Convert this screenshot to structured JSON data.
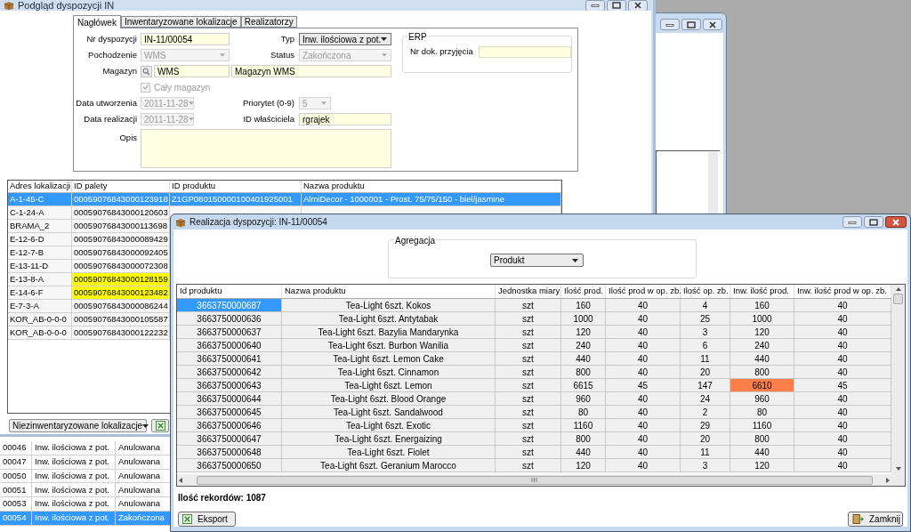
{
  "main_window": {
    "title": "Podgląd dyspozycji IN",
    "tabs": [
      {
        "label": "Nagłówek",
        "selected": true
      },
      {
        "label": "Inwentaryzowane lokalizacje",
        "selected": false
      },
      {
        "label": "Realizatorzy",
        "selected": false
      }
    ],
    "form_rows": [
      {
        "label": "Nr dyspozycji",
        "field": {
          "kind": "text",
          "value": "IN-11/00054",
          "disabled": false
        },
        "label2": "Typ",
        "field2": {
          "kind": "dropdown",
          "value": "Inw. ilościowa z pot.",
          "disabled": false
        }
      },
      {
        "label": "Pochodzenie",
        "field": {
          "kind": "dropdown",
          "value": "WMS",
          "disabled": true
        },
        "label2": "Status",
        "field2": {
          "kind": "dropdown",
          "value": "Zakończona",
          "disabled": true
        }
      },
      {
        "label": "Magazyn",
        "field": {
          "kind": "lookup",
          "value": "WMS",
          "disabled": false
        },
        "field2": {
          "kind": "text",
          "value": "Magazyn WMS",
          "disabled": false
        }
      },
      {
        "field": {
          "kind": "checkbox",
          "value": "Cały magazyn",
          "checked": true,
          "disabled": true
        }
      },
      {
        "label": "Data utworzenia",
        "field": {
          "kind": "date",
          "value": "2011-11-28",
          "disabled": true
        },
        "label2": "Priorytet (0-9)",
        "field2": {
          "kind": "short_dropdown",
          "value": "5",
          "disabled": true
        }
      },
      {
        "label": "Data realizacji",
        "field": {
          "kind": "date",
          "value": "2011-11-28",
          "disabled": true
        },
        "label2": "ID właściciela",
        "field2": {
          "kind": "text",
          "value": "rgrajek",
          "disabled": false
        }
      },
      {
        "label": "Opis",
        "field": {
          "kind": "memo",
          "disabled": false
        }
      }
    ],
    "erp": {
      "legend": "ERP",
      "label": "Nr dok. przyjęcia"
    },
    "locations_table": {
      "columns": [
        "Adres lokalizacji",
        "ID palety",
        "ID produktu",
        "Nazwa produktu"
      ],
      "rows": [
        {
          "cells": [
            "A-1-45-C",
            "00059076843000123918",
            "Z1GP080150000100401925001",
            "AlmiDecor - 1000001 - Prost. 75/75/150 - biel/jasmine"
          ],
          "selected": true,
          "pallet_flagged": false
        },
        {
          "cells": [
            "C-1-24-A",
            "00059076843000120603"
          ],
          "selected": false,
          "pallet_flagged": false
        },
        {
          "cells": [
            "BRAMA_2",
            "00059076843000113698"
          ],
          "selected": false,
          "pallet_flagged": false
        },
        {
          "cells": [
            "E-12-6-D",
            "00059076843000089429"
          ],
          "selected": false,
          "pallet_flagged": false
        },
        {
          "cells": [
            "E-12-7-B",
            "00059076843000092405"
          ],
          "selected": false,
          "pallet_flagged": false
        },
        {
          "cells": [
            "E-13-11-D",
            "00059076843000072308"
          ],
          "selected": false,
          "pallet_flagged": false
        },
        {
          "cells": [
            "E-13-8-A",
            "00059076843000128159"
          ],
          "selected": false,
          "pallet_flagged": true
        },
        {
          "cells": [
            "E-14-6-F",
            "00059076843000123482"
          ],
          "selected": false,
          "pallet_flagged": true
        },
        {
          "cells": [
            "E-7-3-A",
            "00059076843000086244"
          ],
          "selected": false,
          "pallet_flagged": false
        },
        {
          "cells": [
            "KOR_AB-0-0-0",
            "00059076843000105587"
          ],
          "selected": false,
          "pallet_flagged": false
        },
        {
          "cells": [
            "KOR_AB-0-0-0",
            "00059076843000122232"
          ],
          "selected": false,
          "pallet_flagged": false
        }
      ]
    },
    "filter_dropdown": "Niezinwentaryzowane lokalizacje"
  },
  "background_list": {
    "rows": [
      {
        "cells": [
          "00046",
          "Inw. ilościowa z pot.",
          "Anulowana"
        ],
        "selected": false
      },
      {
        "cells": [
          "00047",
          "Inw. ilościowa z pot.",
          "Anulowana"
        ],
        "selected": false
      },
      {
        "cells": [
          "00050",
          "Inw. ilościowa z pot.",
          "Anulowana"
        ],
        "selected": false
      },
      {
        "cells": [
          "00051",
          "Inw. ilościowa z pot.",
          "Anulowana"
        ],
        "selected": false
      },
      {
        "cells": [
          "00053",
          "Inw. ilościowa z pot.",
          "Anulowana"
        ],
        "selected": false
      },
      {
        "cells": [
          "00054",
          "Inw. ilościowa z pot.",
          "Zakończona"
        ],
        "selected": true
      }
    ]
  },
  "dialog": {
    "title": "Realizacja dyspozycji: IN-11/00054",
    "aggregation": {
      "legend": "Agregacja",
      "value": "Produkt"
    },
    "columns": [
      "Id produktu",
      "Nazwa produktu",
      "Jednostka miary",
      "Ilość prod.",
      "Ilość prod w op. zb.",
      "Ilość op. zb.",
      "Inw. ilość prod.",
      "Inw. ilość prod w op. zb."
    ],
    "rows": [
      {
        "cells": [
          "3663750000687",
          "Tea-Light 6szt. Kokos",
          "szt",
          "160",
          "40",
          "4",
          "160",
          "40"
        ],
        "selected": true,
        "discrepancy": false
      },
      {
        "cells": [
          "3663750000636",
          "Tea-Light 6szt. Antytabak",
          "szt",
          "1000",
          "40",
          "25",
          "1000",
          "40"
        ],
        "selected": false,
        "discrepancy": false
      },
      {
        "cells": [
          "3663750000637",
          "Tea-Light 6szt. Bazylia Mandarynka",
          "szt",
          "120",
          "40",
          "3",
          "120",
          "40"
        ],
        "selected": false,
        "discrepancy": false
      },
      {
        "cells": [
          "3663750000640",
          "Tea-Light 6szt. Burbon Wanilia",
          "szt",
          "240",
          "40",
          "6",
          "240",
          "40"
        ],
        "selected": false,
        "discrepancy": false
      },
      {
        "cells": [
          "3663750000641",
          "Tea-Light 6szt. Lemon Cake",
          "szt",
          "440",
          "40",
          "11",
          "440",
          "40"
        ],
        "selected": false,
        "discrepancy": false
      },
      {
        "cells": [
          "3663750000642",
          "Tea-Light 6szt. Cinnamon",
          "szt",
          "800",
          "40",
          "20",
          "800",
          "40"
        ],
        "selected": false,
        "discrepancy": false
      },
      {
        "cells": [
          "3663750000643",
          "Tea-Light 6szt. Lemon",
          "szt",
          "6615",
          "45",
          "147",
          "6610",
          "45"
        ],
        "selected": false,
        "discrepancy": true
      },
      {
        "cells": [
          "3663750000644",
          "Tea-Light 6szt. Blood Orange",
          "szt",
          "960",
          "40",
          "24",
          "960",
          "40"
        ],
        "selected": false,
        "discrepancy": false
      },
      {
        "cells": [
          "3663750000645",
          "Tea-Light 6szt. Sandalwood",
          "szt",
          "80",
          "40",
          "2",
          "80",
          "40"
        ],
        "selected": false,
        "discrepancy": false
      },
      {
        "cells": [
          "3663750000646",
          "Tea-Light 6szt. Exotic",
          "szt",
          "1160",
          "40",
          "29",
          "1160",
          "40"
        ],
        "selected": false,
        "discrepancy": false
      },
      {
        "cells": [
          "3663750000647",
          "Tea-Light 6szt. Energaizing",
          "szt",
          "800",
          "40",
          "20",
          "800",
          "40"
        ],
        "selected": false,
        "discrepancy": false
      },
      {
        "cells": [
          "3663750000648",
          "Tea-Light 6szt. Fiolet",
          "szt",
          "440",
          "40",
          "11",
          "440",
          "40"
        ],
        "selected": false,
        "discrepancy": false
      },
      {
        "cells": [
          "3663750000650",
          "Tea-Light 6szt. Geranium Marocco",
          "szt",
          "120",
          "40",
          "3",
          "120",
          "40"
        ],
        "selected": false,
        "discrepancy": false
      }
    ],
    "record_count": "Ilość rekordów: 1087",
    "buttons": [
      {
        "kind": "export",
        "label": "Eksport"
      },
      {
        "kind": "close",
        "label": "Zamknij"
      }
    ]
  }
}
